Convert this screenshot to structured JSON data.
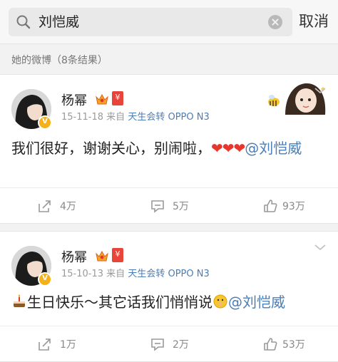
{
  "search": {
    "query": "刘恺威",
    "cancel_label": "取消"
  },
  "results": {
    "header": "她的微博（8条结果）"
  },
  "posts": [
    {
      "user": "杨幂",
      "date": "15-11-18",
      "via": "来自",
      "source": "天生会转",
      "device": "OPPO N3",
      "text": "我们很好，谢谢关心，别闹啦，",
      "emoji": "❤❤❤",
      "mention": "@刘恺威",
      "repost_count": "4万",
      "comment_count": "5万",
      "like_count": "93万"
    },
    {
      "user": "杨幂",
      "date": "15-10-13",
      "via": "来自",
      "source": "天生会转",
      "device": "OPPO N3",
      "text": "生日快乐～其它话我们悄悄说",
      "mention": "@刘恺威",
      "repost_count": "1万",
      "comment_count": "2万",
      "like_count": "53万"
    }
  ],
  "colors": {
    "link": "#4b7db7",
    "badge": "#f6b117",
    "heart": "#e8362d"
  },
  "icons": [
    "search-icon",
    "clear-icon",
    "crown-icon",
    "red-badge-icon",
    "chevron-down-icon",
    "repost-icon",
    "comment-icon",
    "like-icon",
    "cake-icon",
    "shush-emoji-icon"
  ]
}
